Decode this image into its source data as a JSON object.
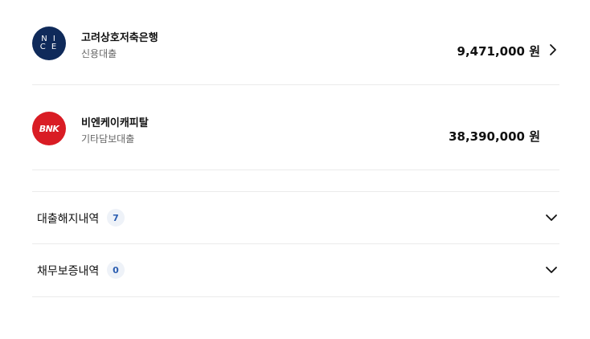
{
  "loans": [
    {
      "institution": "고려상호저축은행",
      "loan_type": "신용대출",
      "amount": "9,471,000 원",
      "logo_text_top": "N I",
      "logo_text_bottom": "C E",
      "logo_color": "#0f2a5a",
      "has_chevron": true,
      "chevron_icon": "chevron-right-icon"
    },
    {
      "institution": "비엔케이캐피탈",
      "loan_type": "기타담보대출",
      "amount": "38,390,000 원",
      "logo_text": "BNK",
      "logo_color": "#d91c24",
      "has_chevron": false
    }
  ],
  "sections": [
    {
      "label": "대출해지내역",
      "count": "7",
      "icon": "chevron-down-icon"
    },
    {
      "label": "채무보증내역",
      "count": "0",
      "icon": "chevron-down-icon"
    }
  ],
  "colors": {
    "badge_bg": "#eef2f8",
    "badge_text": "#2a5db0",
    "divider": "#ebebeb"
  }
}
